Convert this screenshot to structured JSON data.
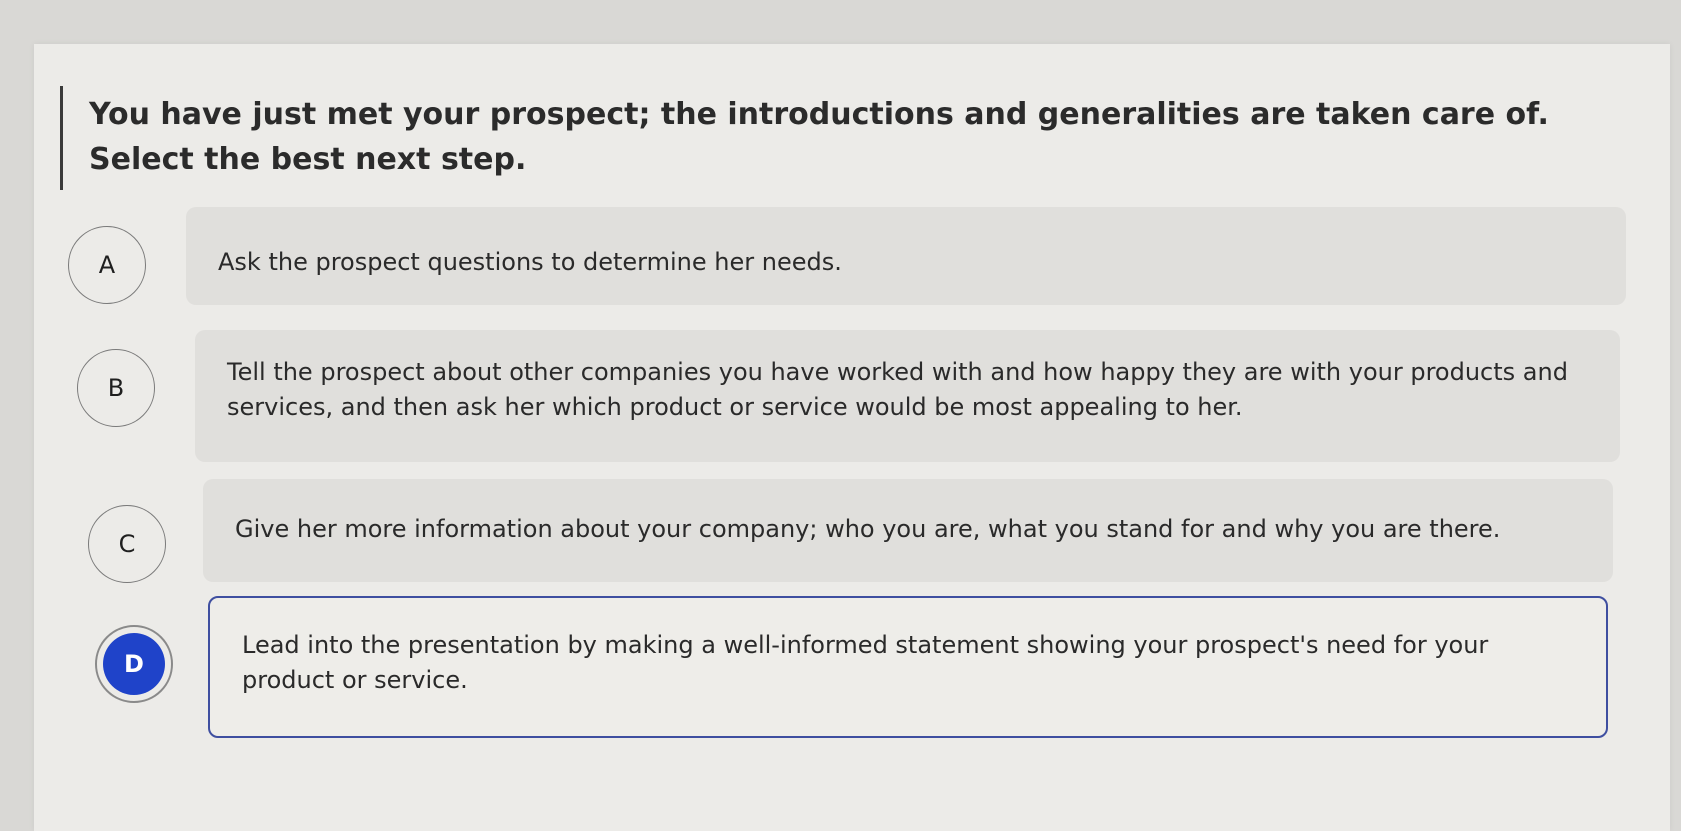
{
  "question": {
    "text": "You have just met your prospect; the introductions and generalities are taken care of. Select the best next step."
  },
  "options": [
    {
      "letter": "A",
      "text": "Ask the prospect questions to determine her needs.",
      "selected": false
    },
    {
      "letter": "B",
      "text": "Tell the prospect about other companies you have worked with and how happy they are with your products and services, and then ask her which product or service would be most appealing to her.",
      "selected": false
    },
    {
      "letter": "C",
      "text": "Give her more information about your company; who you are, what you stand for and why you are there.",
      "selected": false
    },
    {
      "letter": "D",
      "text": "Lead into the presentation by making a well-informed statement showing your prospect's need for your product or service.",
      "selected": true
    }
  ],
  "colors": {
    "selected_accent": "#1f43c9",
    "selected_border": "#3f4fa0"
  }
}
